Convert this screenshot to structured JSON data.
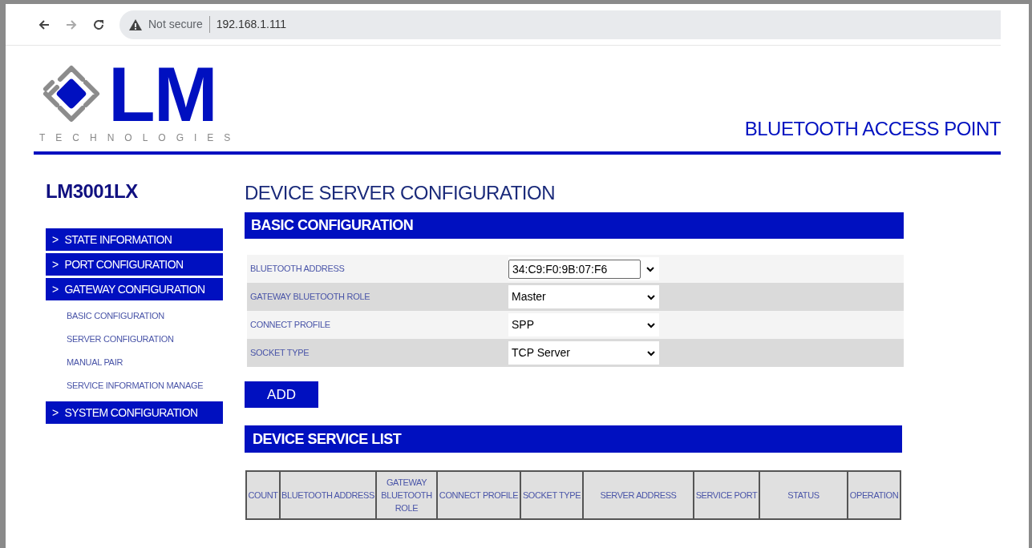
{
  "browser": {
    "security": "Not secure",
    "url": "192.168.1.111"
  },
  "logo": {
    "mark": "LM",
    "tagline": "TECHNOLOGIES"
  },
  "header_title": "BLUETOOTH ACCESS POINT",
  "sidebar": {
    "model": "LM3001LX",
    "items": [
      {
        "arrow": ">",
        "label": "STATE INFORMATION"
      },
      {
        "arrow": ">",
        "label": "PORT CONFIGURATION"
      },
      {
        "arrow": ">",
        "label": "GATEWAY CONFIGURATION",
        "children": [
          {
            "label": "BASIC CONFIGURATION"
          },
          {
            "label": "SERVER CONFIGURATION"
          },
          {
            "label": "MANUAL PAIR"
          },
          {
            "label": "SERVICE INFORMATION MANAGE"
          }
        ]
      },
      {
        "arrow": ">",
        "label": "SYSTEM CONFIGURATION"
      }
    ]
  },
  "page_title": "DEVICE SERVER CONFIGURATION",
  "basic": {
    "heading": "BASIC CONFIGURATION",
    "fields": [
      {
        "kind": "combo",
        "label": "BLUETOOTH ADDRESS",
        "value": "34:C9:F0:9B:07:F6"
      },
      {
        "kind": "select",
        "label": "GATEWAY BLUETOOTH ROLE",
        "value": "Master"
      },
      {
        "kind": "select",
        "label": "CONNECT PROFILE",
        "value": "SPP"
      },
      {
        "kind": "select",
        "label": "SOCKET TYPE",
        "value": "TCP Server"
      }
    ]
  },
  "add_button": "ADD",
  "service_list": {
    "heading": "DEVICE SERVICE LIST",
    "columns": [
      "COUNT",
      "BLUETOOTH ADDRESS",
      "GATEWAY BLUETOOTH ROLE",
      "CONNECT PROFILE",
      "SOCKET TYPE",
      "SERVER ADDRESS",
      "SERVICE PORT",
      "STATUS",
      "OPERATION"
    ]
  }
}
